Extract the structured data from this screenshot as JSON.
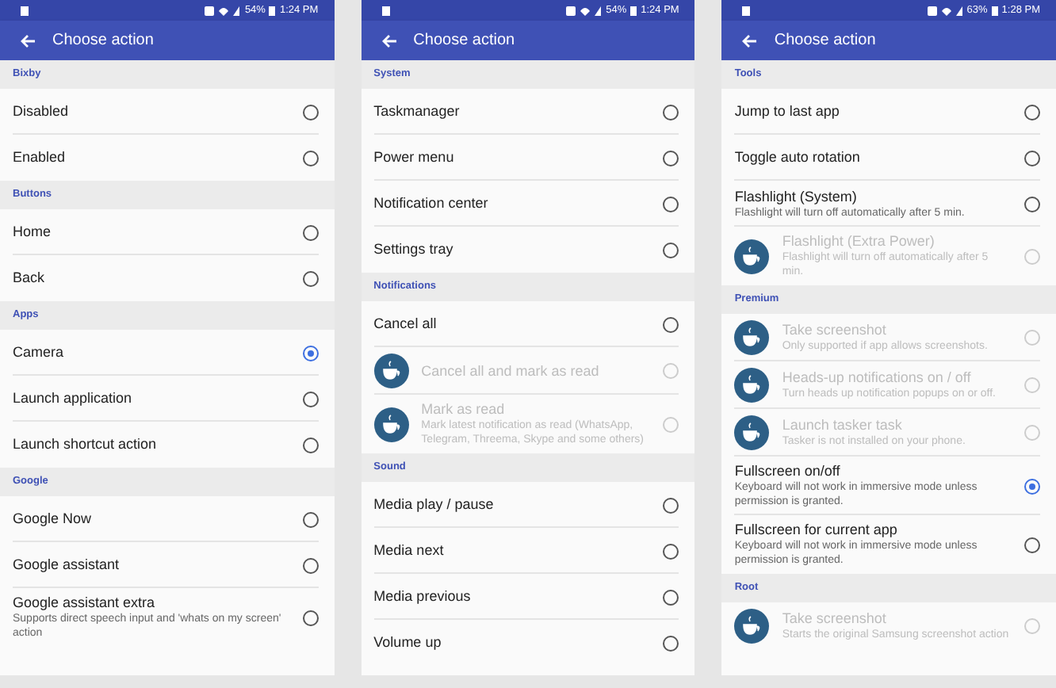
{
  "screens": [
    {
      "status_bar": {
        "battery": "54%",
        "time": "1:24 PM"
      },
      "toolbar": {
        "title": "Choose action"
      },
      "sections": [
        {
          "title": "Bixby",
          "items": [
            {
              "title": "Disabled",
              "selected": false,
              "disabled": false
            },
            {
              "title": "Enabled",
              "selected": false,
              "disabled": false
            }
          ]
        },
        {
          "title": "Buttons",
          "items": [
            {
              "title": "Home",
              "selected": false,
              "disabled": false
            },
            {
              "title": "Back",
              "selected": false,
              "disabled": false
            }
          ]
        },
        {
          "title": "Apps",
          "items": [
            {
              "title": "Camera",
              "selected": true,
              "disabled": false
            },
            {
              "title": "Launch application",
              "selected": false,
              "disabled": false
            },
            {
              "title": "Launch shortcut action",
              "selected": false,
              "disabled": false
            }
          ]
        },
        {
          "title": "Google",
          "items": [
            {
              "title": "Google Now",
              "selected": false,
              "disabled": false
            },
            {
              "title": "Google assistant",
              "selected": false,
              "disabled": false
            },
            {
              "title": "Google assistant extra",
              "subtitle": "Supports direct speech input and 'whats on my screen' action",
              "selected": false,
              "disabled": false
            }
          ]
        }
      ]
    },
    {
      "status_bar": {
        "battery": "54%",
        "time": "1:24 PM"
      },
      "toolbar": {
        "title": "Choose action"
      },
      "sections": [
        {
          "title": "System",
          "items": [
            {
              "title": "Taskmanager",
              "selected": false,
              "disabled": false
            },
            {
              "title": "Power menu",
              "selected": false,
              "disabled": false
            },
            {
              "title": "Notification center",
              "selected": false,
              "disabled": false
            },
            {
              "title": "Settings tray",
              "selected": false,
              "disabled": false
            }
          ]
        },
        {
          "title": "Notifications",
          "items": [
            {
              "title": "Cancel all",
              "selected": false,
              "disabled": false
            },
            {
              "title": "Cancel all and mark as read",
              "selected": false,
              "disabled": true
            },
            {
              "title": "Mark as read",
              "subtitle": "Mark latest notification as read (WhatsApp, Telegram, Threema, Skype and some others)",
              "selected": false,
              "disabled": true
            }
          ]
        },
        {
          "title": "Sound",
          "items": [
            {
              "title": "Media play / pause",
              "selected": false,
              "disabled": false
            },
            {
              "title": "Media next",
              "selected": false,
              "disabled": false
            },
            {
              "title": "Media previous",
              "selected": false,
              "disabled": false
            },
            {
              "title": "Volume up",
              "selected": false,
              "disabled": false
            }
          ]
        }
      ]
    },
    {
      "status_bar": {
        "battery": "63%",
        "time": "1:28 PM"
      },
      "toolbar": {
        "title": "Choose action"
      },
      "sections": [
        {
          "title": "Tools",
          "items": [
            {
              "title": "Jump to last app",
              "selected": false,
              "disabled": false
            },
            {
              "title": "Toggle auto rotation",
              "selected": false,
              "disabled": false
            },
            {
              "title": "Flashlight (System)",
              "subtitle": "Flashlight will turn off automatically after 5 min.",
              "selected": false,
              "disabled": false
            },
            {
              "title": "Flashlight (Extra Power)",
              "subtitle": "Flashlight will turn off automatically after 5 min.",
              "selected": false,
              "disabled": true
            }
          ]
        },
        {
          "title": "Premium",
          "items": [
            {
              "title": "Take screenshot",
              "subtitle": "Only supported if app allows screenshots.",
              "selected": false,
              "disabled": true
            },
            {
              "title": "Heads-up notifications on / off",
              "subtitle": "Turn heads up notification popups on or off.",
              "selected": false,
              "disabled": true
            },
            {
              "title": "Launch tasker task",
              "subtitle": "Tasker is not installed on your phone.",
              "selected": false,
              "disabled": true
            },
            {
              "title": "Fullscreen on/off",
              "subtitle": "Keyboard will not work in immersive mode unless permission is granted.",
              "selected": true,
              "disabled": false
            },
            {
              "title": "Fullscreen for current app",
              "subtitle": "Keyboard will not work in immersive mode unless permission is granted.",
              "selected": false,
              "disabled": false
            }
          ]
        },
        {
          "title": "Root",
          "items": [
            {
              "title": "Take screenshot",
              "subtitle": "Starts the original Samsung screenshot action",
              "selected": false,
              "disabled": true
            }
          ]
        }
      ]
    }
  ]
}
